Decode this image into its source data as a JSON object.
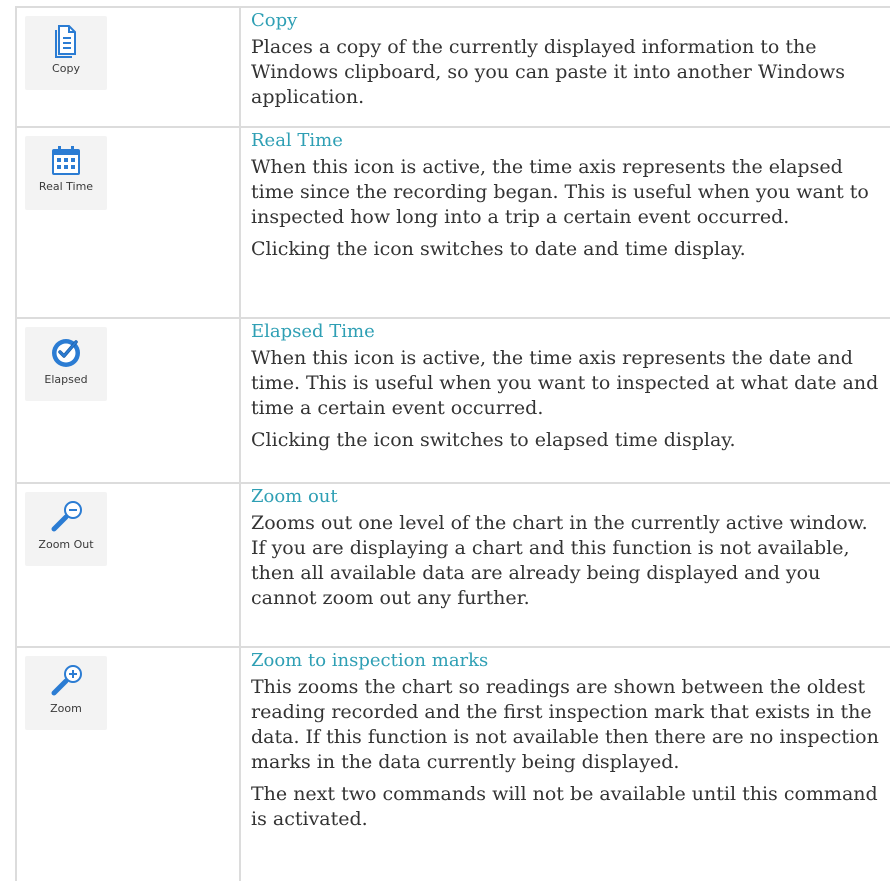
{
  "rows": [
    {
      "icon": "copy-icon",
      "icon_label": "Copy",
      "title": "Copy",
      "paragraphs": [
        "Places a copy of the currently displayed information to the Windows clipboard, so you can paste it into another Windows application."
      ]
    },
    {
      "icon": "calendar-icon",
      "icon_label": "Real Time",
      "title": "Real Time",
      "paragraphs": [
        "When this icon is active, the time axis represents the elapsed time since the recording began. This is useful when you want to inspected how long into a trip a certain event occurred.",
        "Clicking the icon switches to date and time display."
      ]
    },
    {
      "icon": "clock-check-icon",
      "icon_label": "Elapsed",
      "title": "Elapsed Time",
      "paragraphs": [
        "When this icon is active, the time axis represents the date and time. This is useful when you want to inspected at what date and time a certain event occurred.",
        "Clicking the icon switches to elapsed time display."
      ]
    },
    {
      "icon": "zoom-out-icon",
      "icon_label": "Zoom Out",
      "title": "Zoom out",
      "paragraphs": [
        "Zooms out one level of the chart in the currently active window. If you are displaying a chart and this function is not available, then all available data are already being displayed and you cannot zoom out any further."
      ]
    },
    {
      "icon": "zoom-in-icon",
      "icon_label": "Zoom",
      "title": "Zoom to inspection marks",
      "paragraphs": [
        "This zooms the chart so readings are shown between the oldest reading recorded and the first inspection mark that exists in the data. If this function is not available then there are no inspection marks in the data currently being displayed.",
        "The next two commands will not be available until this command is activated."
      ]
    }
  ],
  "colors": {
    "title": "#2e9fb4",
    "icon_blue": "#2b7cd3",
    "border": "#dcdcdc"
  }
}
